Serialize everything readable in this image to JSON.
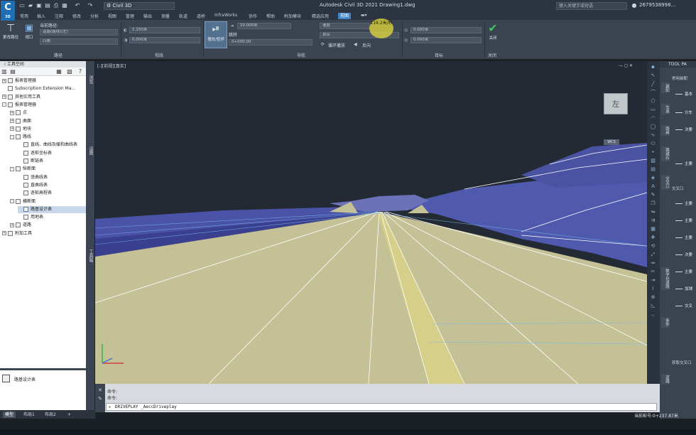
{
  "app": {
    "logo_letter": "C",
    "logo_sub": "3D",
    "workspace": "Civil 3D",
    "window_title": "Autodesk Civil 3D 2021    Drawing1.dwg",
    "search_placeholder": "键入关键字或短语",
    "user": "2679538998..."
  },
  "ribbon_tabs": [
    {
      "label": "常用"
    },
    {
      "label": "插入"
    },
    {
      "label": "注释"
    },
    {
      "label": "修改"
    },
    {
      "label": "分析"
    },
    {
      "label": "视图"
    },
    {
      "label": "管理"
    },
    {
      "label": "输出"
    },
    {
      "label": "测量"
    },
    {
      "label": "轨道"
    },
    {
      "label": "道桥"
    },
    {
      "label": "InfraWorks"
    },
    {
      "label": "协作"
    },
    {
      "label": "帮助"
    },
    {
      "label": "附加模块"
    },
    {
      "label": "精选应用"
    },
    {
      "label": "视图"
    }
  ],
  "ribbon": {
    "path_group": {
      "change_path": "更改路径",
      "viewport": "视口",
      "current_path_label": "当前路径:",
      "path_value": "道路(路线)(左)",
      "path_sub": "凸侧",
      "label": "路径"
    },
    "view_group": {
      "height_value": "1.150米",
      "offset_value": "0.000米",
      "label": "视线"
    },
    "nav_group": {
      "play_pause": "播放/暂停",
      "distance_value": "10.000米",
      "jump_label": "跳转",
      "station_value": "0+000.00",
      "speed_label": "速度",
      "visual_style": "真实",
      "loop_play": "循环播放",
      "reverse": "反向",
      "speed_overlay": "119.2米/秒",
      "label": "导航"
    },
    "target_group": {
      "target_x": "0.000米",
      "target_y": "0.000米",
      "label": "目标"
    },
    "close_group": {
      "close": "关闭",
      "label": "关闭"
    }
  },
  "left_panel": {
    "title": "工具空间",
    "tree": [
      {
        "label": "报表管理器",
        "indent": 0,
        "toggle": "+"
      },
      {
        "label": "Subscription Extension Ma...",
        "indent": 0,
        "toggle": ""
      },
      {
        "label": "其他实用工具",
        "indent": 0,
        "toggle": "+"
      },
      {
        "label": "报表管理器",
        "indent": 0,
        "toggle": "-"
      },
      {
        "label": "点",
        "indent": 1,
        "toggle": "+"
      },
      {
        "label": "曲面",
        "indent": 1,
        "toggle": "+"
      },
      {
        "label": "地块",
        "indent": 1,
        "toggle": "+"
      },
      {
        "label": "路线",
        "indent": 1,
        "toggle": "-"
      },
      {
        "label": "直线、曲线及缓和曲线表",
        "indent": 2,
        "toggle": ""
      },
      {
        "label": "逐桩坐标表",
        "indent": 2,
        "toggle": ""
      },
      {
        "label": "断链表",
        "indent": 2,
        "toggle": ""
      },
      {
        "label": "纵断面",
        "indent": 1,
        "toggle": "-"
      },
      {
        "label": "竖曲线表",
        "indent": 2,
        "toggle": ""
      },
      {
        "label": "直曲线表",
        "indent": 2,
        "toggle": ""
      },
      {
        "label": "逐桩高程表",
        "indent": 2,
        "toggle": ""
      },
      {
        "label": "横断面",
        "indent": 1,
        "toggle": "-"
      },
      {
        "label": "路基设计表",
        "indent": 2,
        "toggle": "",
        "selected": true
      },
      {
        "label": "用地表",
        "indent": 2,
        "toggle": ""
      },
      {
        "label": "道路",
        "indent": 1,
        "toggle": "+"
      },
      {
        "label": "附加工具",
        "indent": 0,
        "toggle": "+"
      }
    ],
    "bottom_label": "路基设计表",
    "vtabs": [
      "浏览",
      "设置",
      "工具箱"
    ]
  },
  "viewport": {
    "label": "[-][前视][真实]",
    "controls": "— ◻ ✕",
    "viewcube_face": "左",
    "wcs": "WCS"
  },
  "tool_palette": {
    "title": "TOOL PA",
    "sections": [
      "常用装配",
      "交叉口",
      "获取交叉口"
    ],
    "items": [
      "基本",
      "分车",
      "次要",
      "主要",
      "主要",
      "主要",
      "主要",
      "次要",
      "主要",
      "加铺",
      "交叉"
    ],
    "vtabs": [
      "装配",
      "车道",
      "路肩",
      "路缘石",
      "交叉口",
      "数字化道路",
      "条件",
      "道路"
    ]
  },
  "command": {
    "history_1": "命令:",
    "history_2": "命令:",
    "input": "DRIVEPLAY _AeccDriveplay"
  },
  "layouts": [
    {
      "label": "模型",
      "active": true
    },
    {
      "label": "布局1",
      "active": false
    },
    {
      "label": "布局2",
      "active": false
    }
  ],
  "status": {
    "coords": "当前桩号:0+237.87米"
  },
  "colors": {
    "ground": "#c5c197",
    "water": "#4b53a8",
    "sky": "#232a34"
  }
}
